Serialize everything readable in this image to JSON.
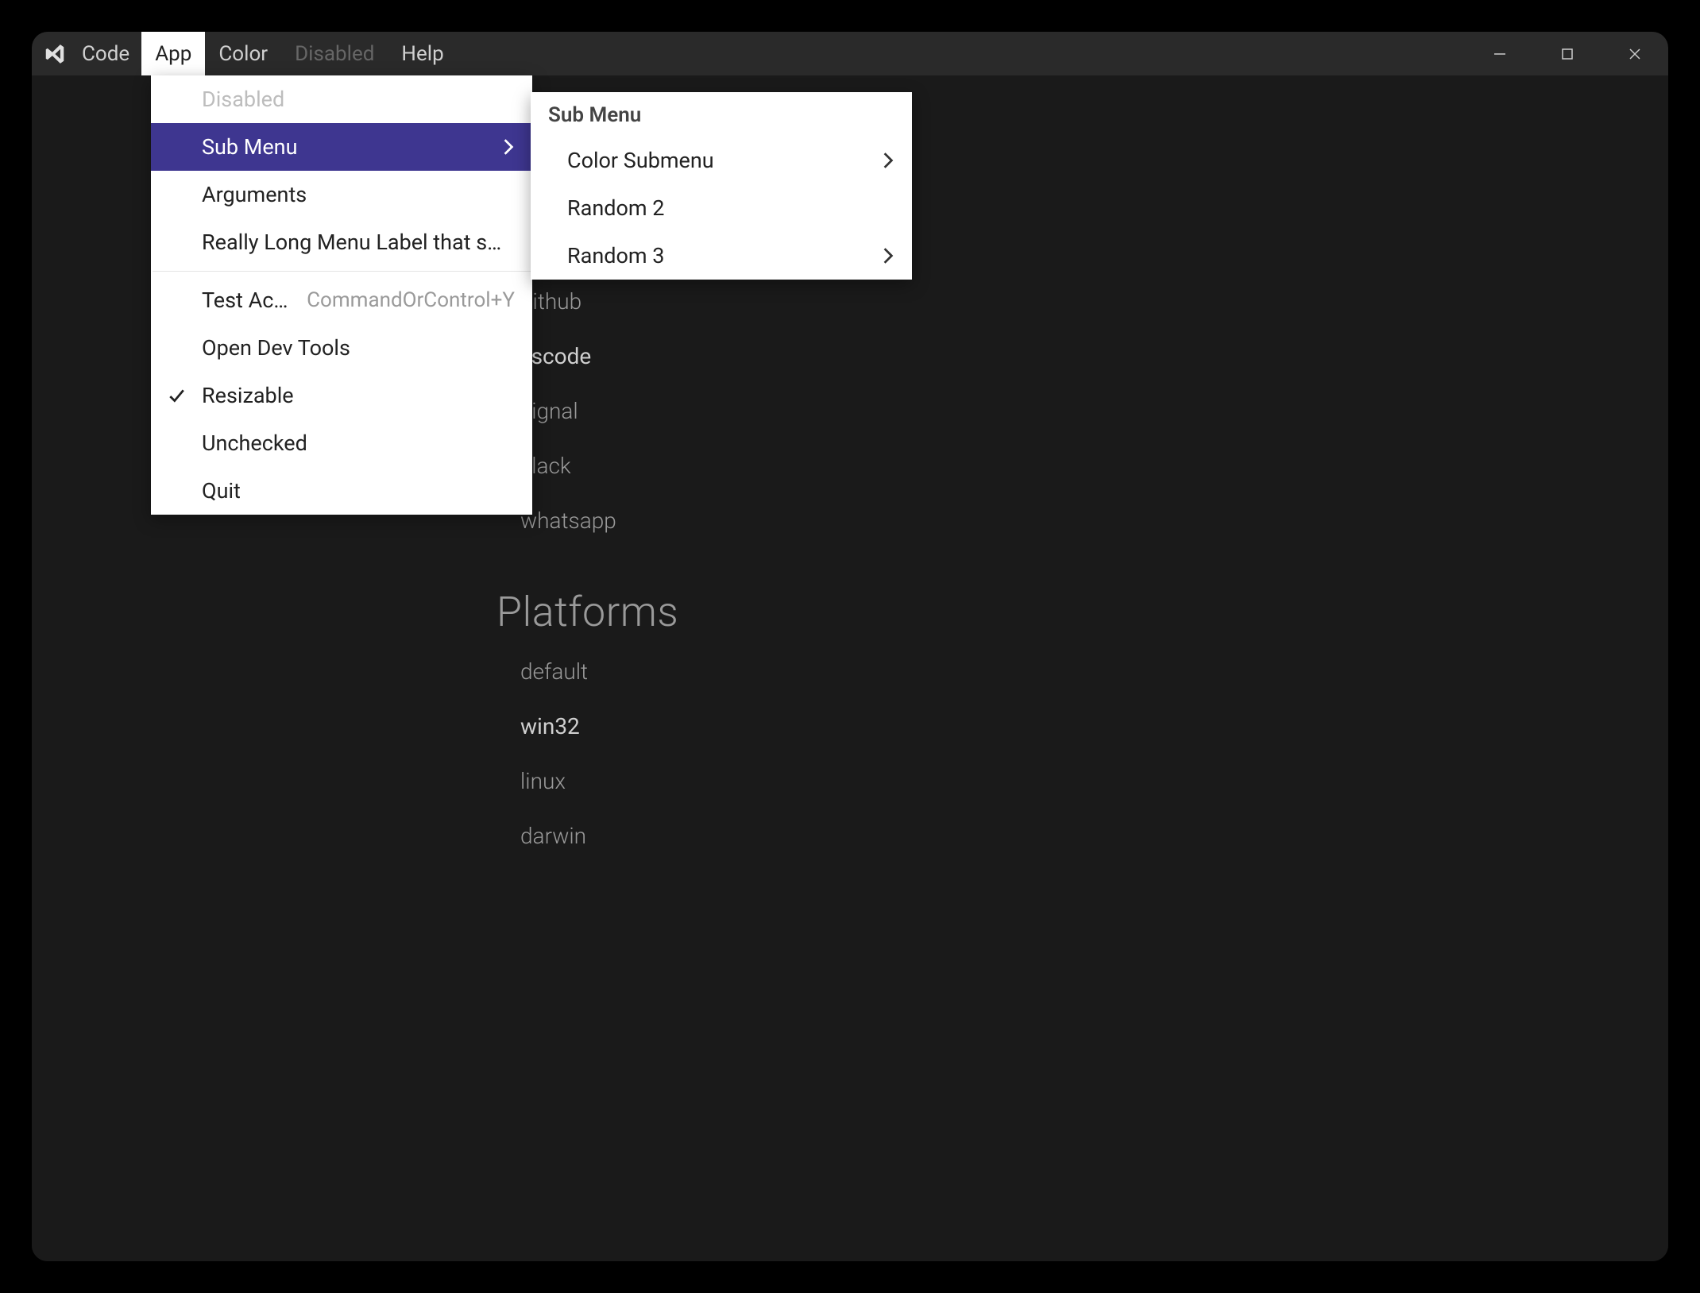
{
  "app_title": "Code",
  "menubar": {
    "items": [
      {
        "label": "App",
        "active": true,
        "disabled": false
      },
      {
        "label": "Color",
        "active": false,
        "disabled": false
      },
      {
        "label": "Disabled",
        "active": false,
        "disabled": true
      },
      {
        "label": "Help",
        "active": false,
        "disabled": false
      }
    ]
  },
  "app_menu": {
    "items": [
      {
        "label": "Disabled",
        "disabled": true
      },
      {
        "label": "Sub Menu",
        "submenu": true,
        "highlight": true
      },
      {
        "label": "Arguments"
      },
      {
        "label": "Really Long Menu Label that s…"
      },
      {
        "separator": true
      },
      {
        "label": "Test Ac…",
        "accelerator": "CommandOrControl+Y"
      },
      {
        "label": "Open Dev Tools"
      },
      {
        "label": "Resizable",
        "checked": true
      },
      {
        "label": "Unchecked"
      },
      {
        "label": "Quit"
      }
    ]
  },
  "sub_menu": {
    "title": "Sub Menu",
    "items": [
      {
        "label": "Color Submenu",
        "submenu": true
      },
      {
        "label": "Random 2"
      },
      {
        "label": "Random 3",
        "submenu": true
      }
    ]
  },
  "content": {
    "visible_apps": [
      {
        "label": "github",
        "active": false
      },
      {
        "label": "vscode",
        "active": true
      },
      {
        "label": "signal",
        "active": false
      },
      {
        "label": "slack",
        "active": false
      },
      {
        "label": "whatsapp",
        "active": false
      }
    ],
    "platforms_heading": "Platforms",
    "platforms": [
      {
        "label": "default",
        "active": false
      },
      {
        "label": "win32",
        "active": true
      },
      {
        "label": "linux",
        "active": false
      },
      {
        "label": "darwin",
        "active": false
      }
    ]
  }
}
